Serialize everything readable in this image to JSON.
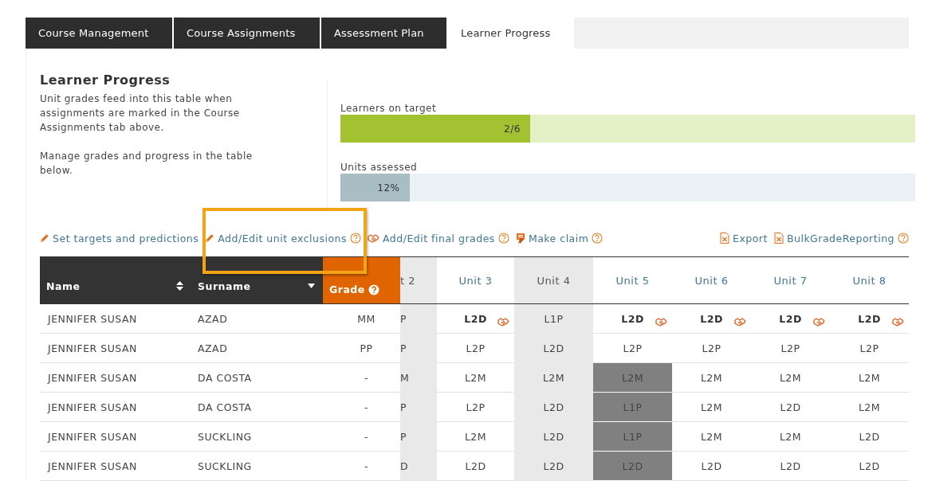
{
  "tabs": [
    {
      "label": "Course Management",
      "selected": false
    },
    {
      "label": "Course Assignments",
      "selected": false
    },
    {
      "label": "Assessment Plan",
      "selected": false
    },
    {
      "label": "Learner Progress",
      "selected": true
    }
  ],
  "intro": {
    "title": "Learner Progress",
    "paragraphs": [
      "Unit grades feed into this table when assignments are marked in the Course Assignments tab above.",
      "Manage grades and progress in the table below."
    ]
  },
  "meters": [
    {
      "kind": "target",
      "label": "Learners on target",
      "level": 0.33,
      "reading": "2/6"
    },
    {
      "kind": "units",
      "label": "Units assessed",
      "level": 0.12,
      "reading": "12%"
    }
  ],
  "toolbar": {
    "left": [
      {
        "kind": "pencil",
        "label": "Set targets and predictions",
        "help": false
      },
      {
        "kind": "pencil",
        "label": "Add/Edit unit exclusions",
        "help": true
      },
      {
        "kind": "handshake",
        "label": "Add/Edit final grades",
        "help": true
      },
      {
        "kind": "award",
        "label": "Make claim",
        "help": true
      }
    ],
    "right": [
      {
        "kind": "file",
        "label": "Export",
        "help": false
      },
      {
        "kind": "file",
        "label": "BulkGradeReporting",
        "help": true
      }
    ]
  },
  "table": {
    "columns": [
      {
        "kind": "name",
        "label": "Name",
        "sorted": false
      },
      {
        "kind": "surname",
        "label": "Surname",
        "sorted": true
      },
      {
        "kind": "overall",
        "label": "Grade",
        "help": true
      },
      {
        "kind": "unit",
        "label": "t 2",
        "shaded": true
      },
      {
        "kind": "unit",
        "label": "Unit 3",
        "shaded": false
      },
      {
        "kind": "unit",
        "label": "Unit 4",
        "shaded": true
      },
      {
        "kind": "unit",
        "label": "Unit 5",
        "shaded": false
      },
      {
        "kind": "unit",
        "label": "Unit 6",
        "shaded": false
      },
      {
        "kind": "unit",
        "label": "Unit 7",
        "shaded": false
      },
      {
        "kind": "unit",
        "label": "Unit 8",
        "shaded": false
      }
    ],
    "rows": [
      {
        "name": "JENNIFER SUSAN",
        "surname": "AZAD",
        "overall": "MM",
        "units": [
          {
            "grade": "P",
            "final": false,
            "excluded": false
          },
          {
            "grade": "L2D",
            "final": true,
            "excluded": false
          },
          {
            "grade": "L1P",
            "final": false,
            "excluded": false
          },
          {
            "grade": "L2D",
            "final": true,
            "excluded": false
          },
          {
            "grade": "L2D",
            "final": true,
            "excluded": false
          },
          {
            "grade": "L2D",
            "final": true,
            "excluded": false
          },
          {
            "grade": "L2D",
            "final": true,
            "excluded": false
          }
        ]
      },
      {
        "name": "JENNIFER SUSAN",
        "surname": "AZAD",
        "overall": "PP",
        "units": [
          {
            "grade": "P",
            "final": false,
            "excluded": false
          },
          {
            "grade": "L2P",
            "final": false,
            "excluded": false
          },
          {
            "grade": "L2D",
            "final": false,
            "excluded": false
          },
          {
            "grade": "L2P",
            "final": false,
            "excluded": false
          },
          {
            "grade": "L2P",
            "final": false,
            "excluded": false
          },
          {
            "grade": "L2P",
            "final": false,
            "excluded": false
          },
          {
            "grade": "L2P",
            "final": false,
            "excluded": false
          }
        ]
      },
      {
        "name": "JENNIFER SUSAN",
        "surname": "DA COSTA",
        "overall": "-",
        "units": [
          {
            "grade": "M",
            "final": false,
            "excluded": false
          },
          {
            "grade": "L2M",
            "final": false,
            "excluded": false
          },
          {
            "grade": "L2M",
            "final": false,
            "excluded": false
          },
          {
            "grade": "L2M",
            "final": false,
            "excluded": true
          },
          {
            "grade": "L2M",
            "final": false,
            "excluded": false
          },
          {
            "grade": "L2M",
            "final": false,
            "excluded": false
          },
          {
            "grade": "L2M",
            "final": false,
            "excluded": false
          }
        ]
      },
      {
        "name": "JENNIFER SUSAN",
        "surname": "DA COSTA",
        "overall": "-",
        "units": [
          {
            "grade": "P",
            "final": false,
            "excluded": false
          },
          {
            "grade": "L2P",
            "final": false,
            "excluded": false
          },
          {
            "grade": "L2D",
            "final": false,
            "excluded": false
          },
          {
            "grade": "L1P",
            "final": false,
            "excluded": true
          },
          {
            "grade": "L2M",
            "final": false,
            "excluded": false
          },
          {
            "grade": "L2D",
            "final": false,
            "excluded": false
          },
          {
            "grade": "L2M",
            "final": false,
            "excluded": false
          }
        ]
      },
      {
        "name": "JENNIFER SUSAN",
        "surname": "SUCKLING",
        "overall": "-",
        "units": [
          {
            "grade": "P",
            "final": false,
            "excluded": false
          },
          {
            "grade": "L2M",
            "final": false,
            "excluded": false
          },
          {
            "grade": "L2D",
            "final": false,
            "excluded": false
          },
          {
            "grade": "L1P",
            "final": false,
            "excluded": true
          },
          {
            "grade": "L2M",
            "final": false,
            "excluded": false
          },
          {
            "grade": "L2M",
            "final": false,
            "excluded": false
          },
          {
            "grade": "L2D",
            "final": false,
            "excluded": false
          }
        ]
      },
      {
        "name": "JENNIFER SUSAN",
        "surname": "SUCKLING",
        "overall": "-",
        "units": [
          {
            "grade": "D",
            "final": false,
            "excluded": false
          },
          {
            "grade": "L2D",
            "final": false,
            "excluded": false
          },
          {
            "grade": "L2D",
            "final": false,
            "excluded": false
          },
          {
            "grade": "L2D",
            "final": false,
            "excluded": true
          },
          {
            "grade": "L2D",
            "final": false,
            "excluded": false
          },
          {
            "grade": "L2D",
            "final": false,
            "excluded": false
          },
          {
            "grade": "L2D",
            "final": false,
            "excluded": false
          }
        ]
      }
    ]
  }
}
